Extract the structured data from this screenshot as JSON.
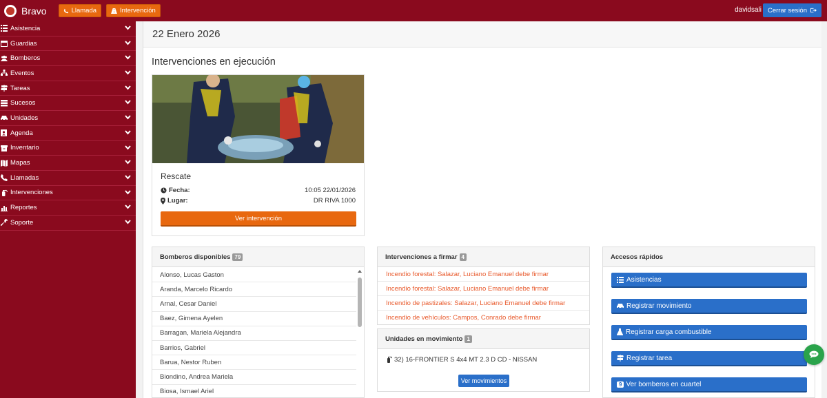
{
  "header": {
    "brand": "Bravo",
    "llamada_label": "Llamada",
    "intervencion_label": "Intervención",
    "username": "davidsali",
    "logout_label": "Cerrar sesión"
  },
  "sidebar": {
    "items": [
      {
        "label": "Asistencia",
        "icon": "list-icon"
      },
      {
        "label": "Guardias",
        "icon": "calendar-icon"
      },
      {
        "label": "Bomberos",
        "icon": "users-icon"
      },
      {
        "label": "Eventos",
        "icon": "sitemap-icon"
      },
      {
        "label": "Tareas",
        "icon": "signpost-icon"
      },
      {
        "label": "Sucesos",
        "icon": "stack-icon"
      },
      {
        "label": "Unidades",
        "icon": "car-icon"
      },
      {
        "label": "Agenda",
        "icon": "contact-book-icon"
      },
      {
        "label": "Inventario",
        "icon": "box-icon"
      },
      {
        "label": "Mapas",
        "icon": "map-icon"
      },
      {
        "label": "Llamadas",
        "icon": "phone-icon"
      },
      {
        "label": "Intervenciones",
        "icon": "extinguisher-icon"
      },
      {
        "label": "Reportes",
        "icon": "bar-chart-icon"
      },
      {
        "label": "Soporte",
        "icon": "wrench-icon"
      }
    ]
  },
  "main": {
    "date": "22 Enero 2026",
    "section_title": "Intervenciones en ejecución",
    "intervention": {
      "type": "Rescate",
      "fecha_label": "Fecha:",
      "fecha_value": "10:05 22/01/2026",
      "lugar_label": "Lugar:",
      "lugar_value": "DR RIVA 1000",
      "button": "Ver intervención"
    },
    "bomberos": {
      "title": "Bomberos disponibles",
      "count": "79",
      "names": [
        "Alonso, Lucas Gaston",
        "Aranda, Marcelo Ricardo",
        "Arnal, Cesar Daniel",
        "Baez, Gimena Ayelen",
        "Barragan, Mariela Alejandra",
        "Barrios, Gabriel",
        "Barua, Nestor Ruben",
        "Biondino, Andrea Mariela",
        "Biosa, Ismael Ariel"
      ]
    },
    "firmar": {
      "title": "Intervenciones a firmar",
      "count": "4",
      "items": [
        "Incendio forestal: Salazar, Luciano Emanuel debe firmar",
        "Incendio forestal: Salazar, Luciano Emanuel debe firmar",
        "Incendio de pastizales: Salazar, Luciano Emanuel debe firmar",
        "Incendio de vehículos: Campos, Conrado debe firmar"
      ]
    },
    "unidades": {
      "title": "Unidades en movimiento",
      "count": "1",
      "items": [
        "32) 16-FRONTIER S 4x4 MT 2.3 D CD - NISSAN"
      ],
      "button": "Ver movimientos"
    },
    "accesos": {
      "title": "Accesos rápidos",
      "buttons": [
        {
          "label": "Asistencias",
          "icon": "list-icon"
        },
        {
          "label": "Registrar movimiento",
          "icon": "car-icon"
        },
        {
          "label": "Registrar carga combustible",
          "icon": "flask-icon"
        },
        {
          "label": "Registrar tarea",
          "icon": "signpost-icon"
        },
        {
          "label": "Ver bomberos en cuartel",
          "badge": "9"
        }
      ]
    }
  },
  "colors": {
    "sidebar_bg": "#8a0a1e",
    "accent_orange": "#e8680f",
    "accent_blue": "#2a6fc9",
    "link_red": "#e8582a",
    "chat_green": "#2aa34b"
  }
}
